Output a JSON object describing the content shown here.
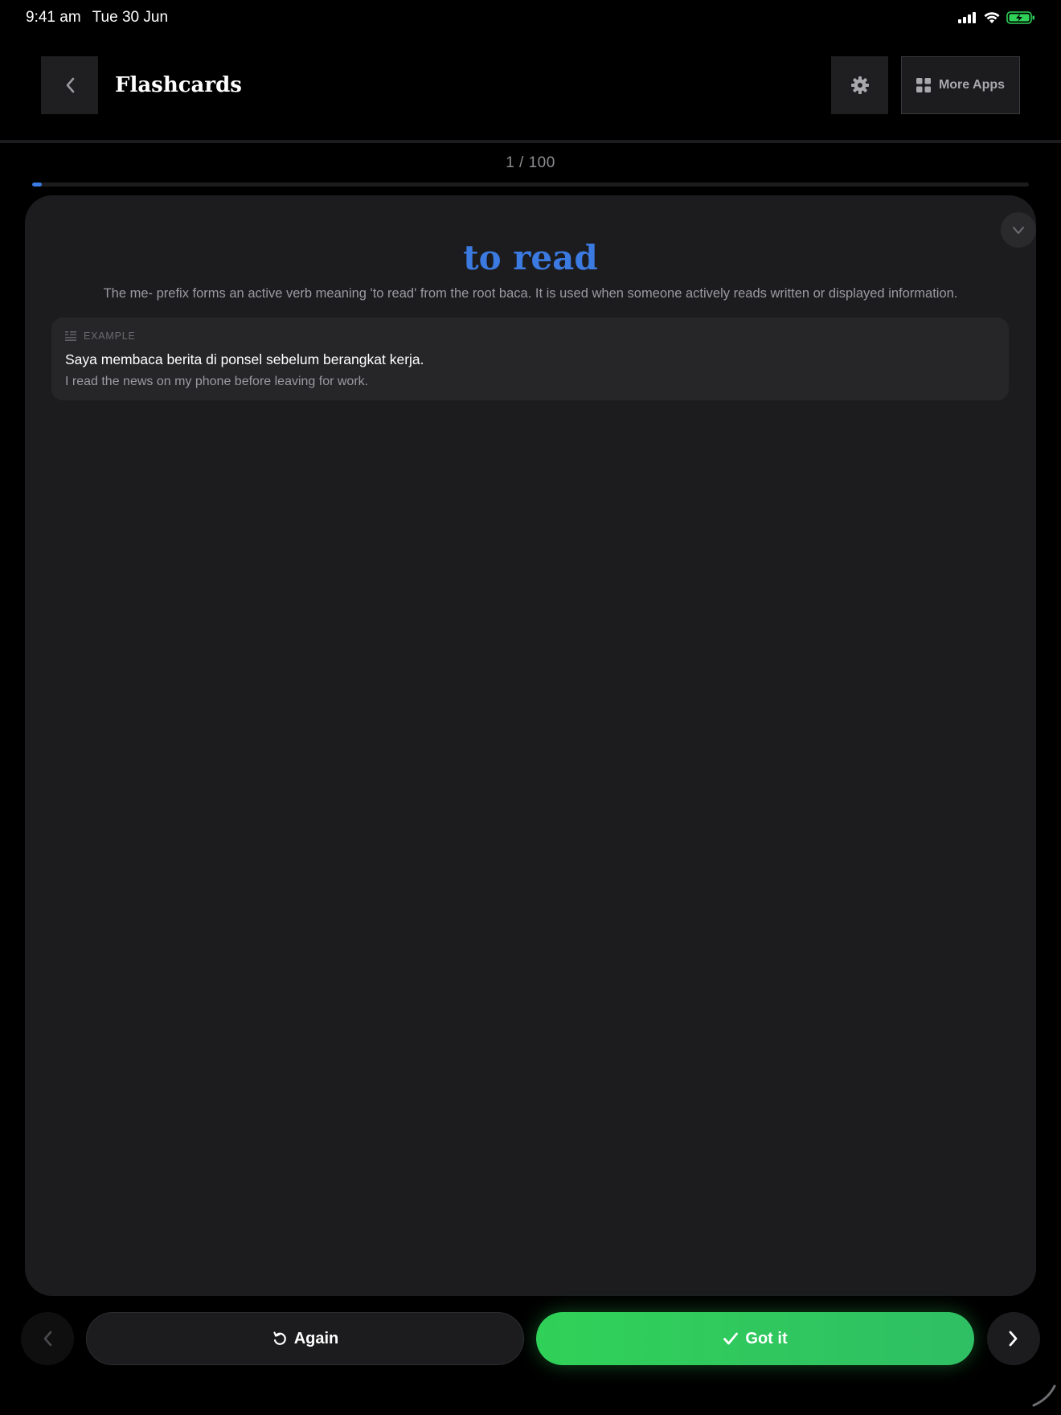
{
  "status_bar": {
    "time": "9:41 am",
    "date": "Tue 30 Jun",
    "icons": [
      "cellular-signal-icon",
      "wifi-icon",
      "battery-charging-icon"
    ],
    "battery_color": "#30d158"
  },
  "header": {
    "back_icon": "chevron-left-icon",
    "title": "Flashcards",
    "settings_icon": "gear-icon",
    "more_apps_icon": "grid-icon",
    "more_apps_label": "More Apps"
  },
  "progress": {
    "text": "1 / 100",
    "current": 1,
    "total": 100,
    "accent": "#3b7ae0"
  },
  "card": {
    "collapse_icon": "chevron-down-icon",
    "term": "to read",
    "term_color": "#3b7ae0",
    "explanation": "The me- prefix forms an active verb meaning 'to read' from the root baca. It is used when someone actively reads written or displayed information.",
    "example": {
      "icon": "text-lines-icon",
      "label": "EXAMPLE",
      "sentence": "Saya membaca berita di ponsel sebelum berangkat kerja.",
      "translation": "I read the news on my phone before leaving for work."
    }
  },
  "actions": {
    "prev_icon": "chevron-left-icon",
    "again_icon": "rotate-ccw-icon",
    "again_label": "Again",
    "gotit_icon": "checkmark-icon",
    "gotit_label": "Got it",
    "gotit_color": "#30d158",
    "next_icon": "chevron-right-icon"
  }
}
